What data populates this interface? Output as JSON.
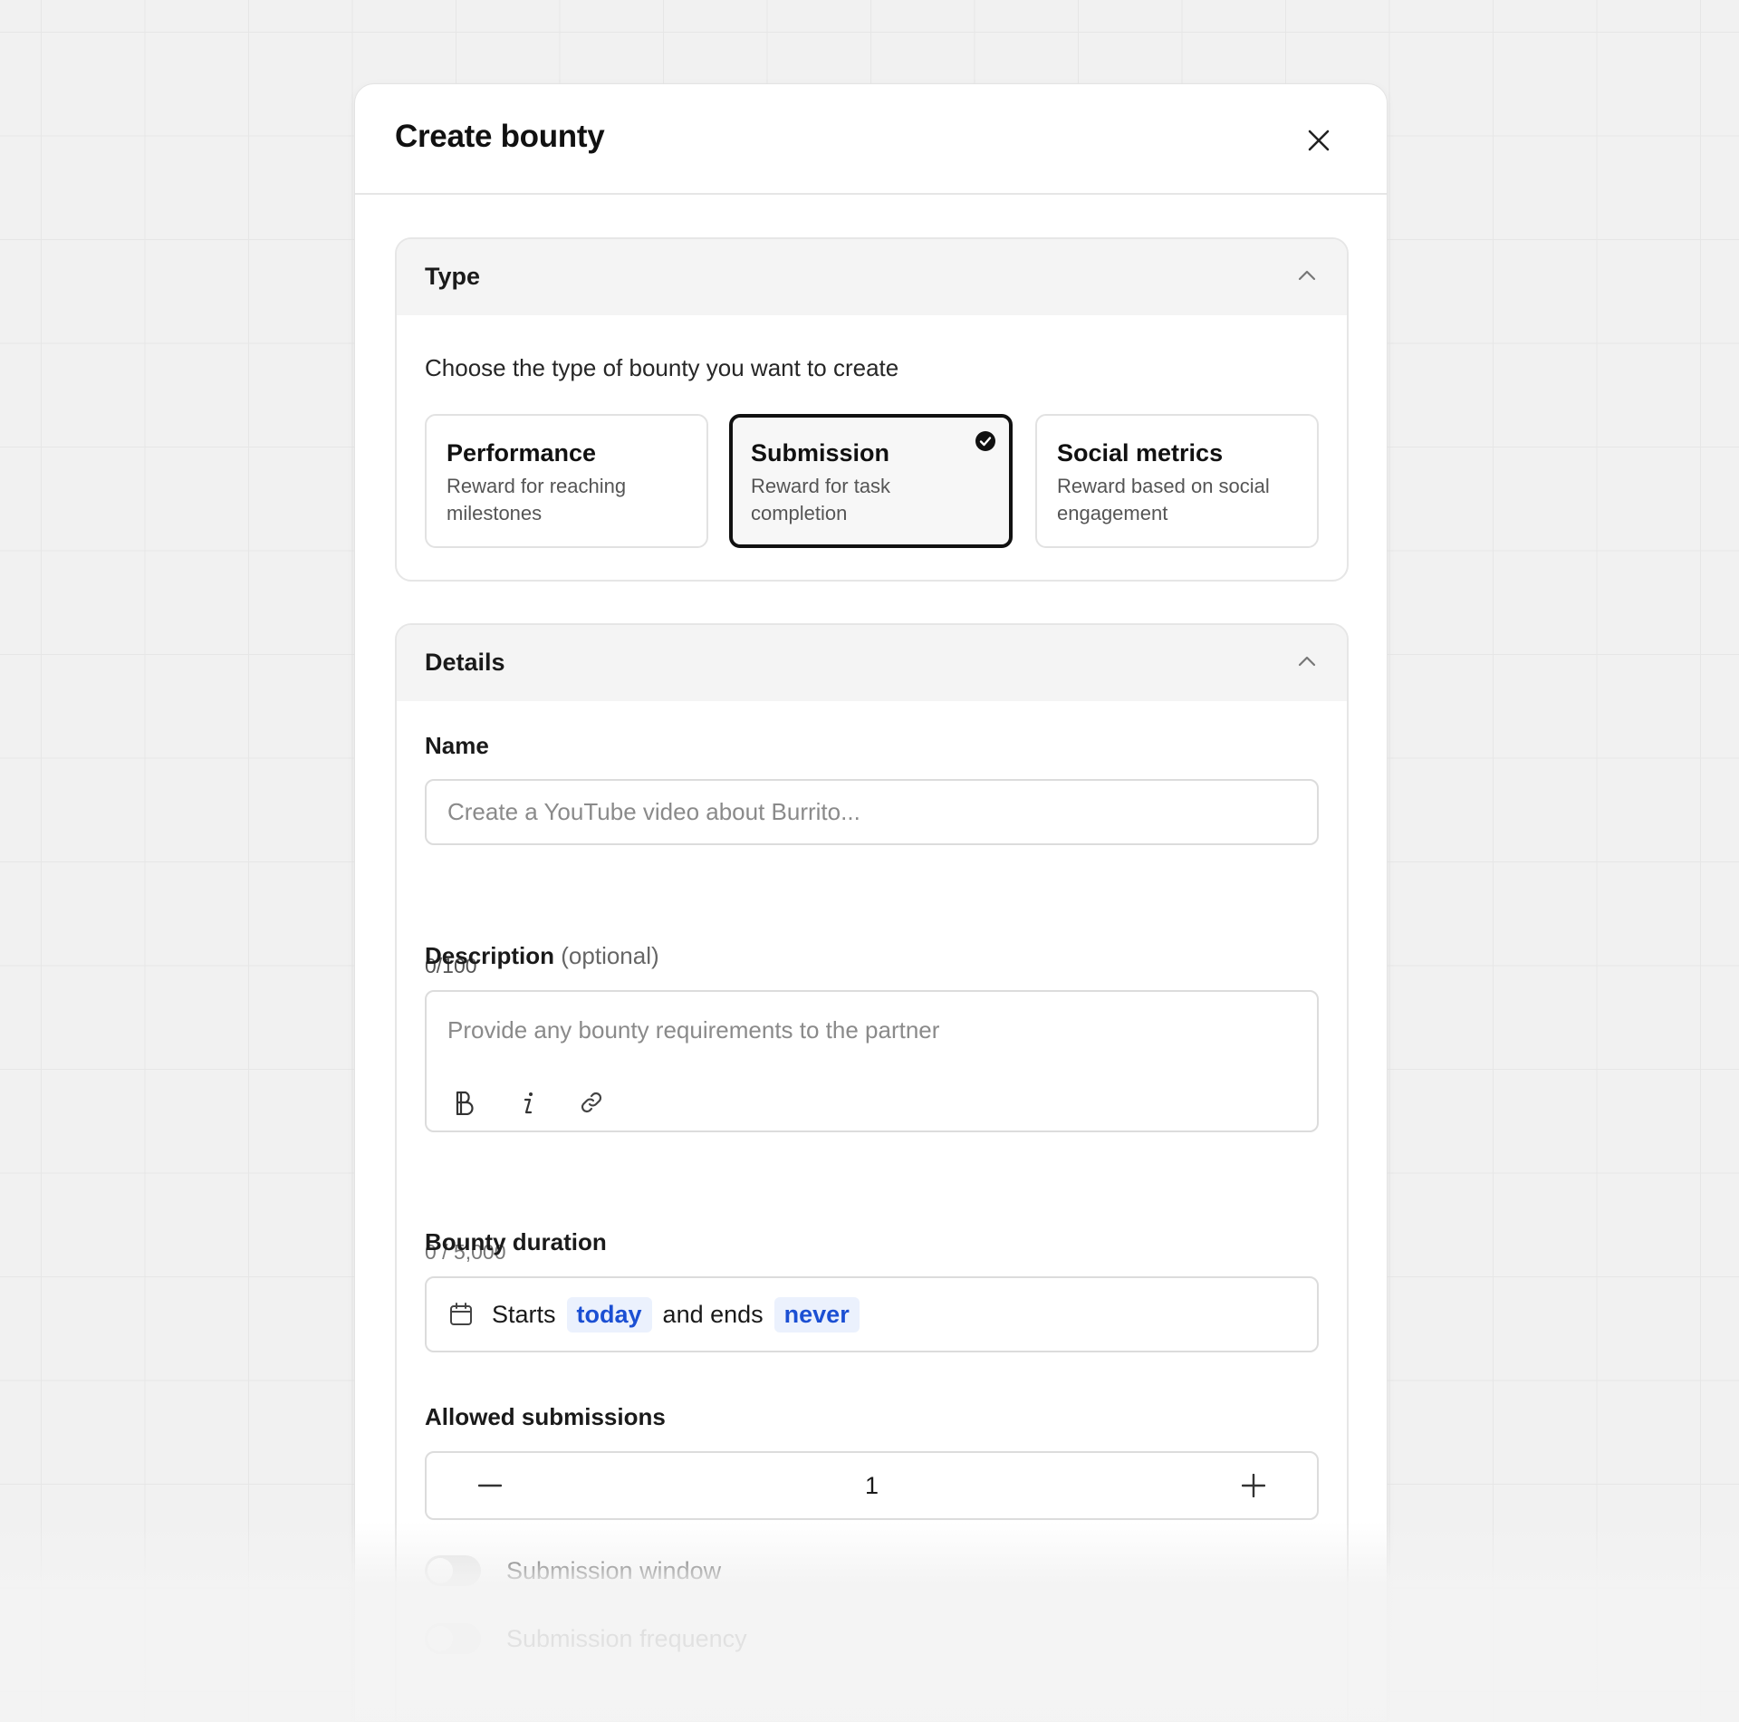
{
  "modal": {
    "title": "Create bounty"
  },
  "type_section": {
    "title": "Type",
    "prompt": "Choose the type of bounty you want to create",
    "options": [
      {
        "title": "Performance",
        "desc": "Reward for reaching milestones",
        "selected": false
      },
      {
        "title": "Submission",
        "desc": "Reward for task completion",
        "selected": true
      },
      {
        "title": "Social metrics",
        "desc": "Reward based on social engagement",
        "selected": false
      }
    ]
  },
  "details_section": {
    "title": "Details",
    "name": {
      "label": "Name",
      "placeholder": "Create a YouTube video about Burrito...",
      "value": "",
      "counter": "0/100"
    },
    "description": {
      "label": "Description",
      "optional": "(optional)",
      "placeholder": "Provide any bounty requirements to the partner",
      "counter": "0 / 5,000",
      "tools": [
        "bold-icon",
        "italic-icon",
        "link-icon"
      ]
    },
    "duration": {
      "label": "Bounty duration",
      "starts_prefix": "Starts",
      "start_value": "today",
      "ends_prefix": "and ends",
      "end_value": "never"
    },
    "submissions": {
      "label": "Allowed submissions",
      "value": "1"
    },
    "toggles": [
      {
        "label": "Submission window",
        "on": false
      },
      {
        "label": "Submission frequency",
        "on": false
      }
    ]
  },
  "colors": {
    "accent_pill_text": "#1b4fd3",
    "accent_pill_bg": "#ebf1fd",
    "selected_border": "#111111"
  }
}
